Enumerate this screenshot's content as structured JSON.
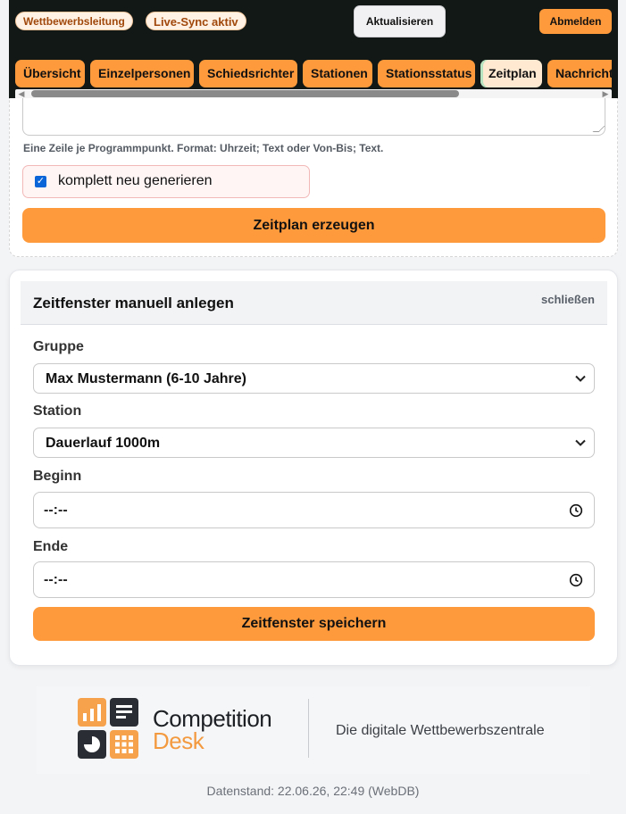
{
  "header": {
    "badge_role": "Wettbewerbsleitung",
    "badge_sync": "Live-Sync aktiv",
    "refresh_label": "Aktualisieren",
    "logout_label": "Abmelden"
  },
  "tabs": [
    {
      "label": "Übersicht",
      "active": false
    },
    {
      "label": "Einzelpersonen",
      "active": false
    },
    {
      "label": "Schiedsrichter",
      "active": false
    },
    {
      "label": "Stationen",
      "active": false
    },
    {
      "label": "Stationsstatus",
      "active": false
    },
    {
      "label": "Zeitplan",
      "active": true
    },
    {
      "label": "Nachrichten",
      "active": false
    }
  ],
  "schedule_generator": {
    "hint": "Eine Zeile je Programmpunkt. Format: Uhrzeit; Text oder Von-Bis; Text.",
    "regenerate_label": "komplett neu generieren",
    "regenerate_checked": true,
    "generate_button": "Zeitplan erzeugen"
  },
  "manual_slot": {
    "title": "Zeitfenster manuell anlegen",
    "close_label": "schließen",
    "group_label": "Gruppe",
    "group_value": "Max Mustermann (6-10 Jahre)",
    "station_label": "Station",
    "station_value": "Dauerlauf 1000m",
    "start_label": "Beginn",
    "start_value": "--:--",
    "end_label": "Ende",
    "end_value": "--:--",
    "save_button": "Zeitfenster speichern"
  },
  "footer": {
    "brand_line1": "Competition",
    "brand_line2": "Desk",
    "tagline": "Die digitale Wettbewerbszentrale",
    "datestamp": "Datenstand: 22.06.26, 22:49 (WebDB)"
  },
  "colors": {
    "accent": "#ff9a3c",
    "header_bg": "#111815",
    "checkbox": "#0a66d8"
  }
}
